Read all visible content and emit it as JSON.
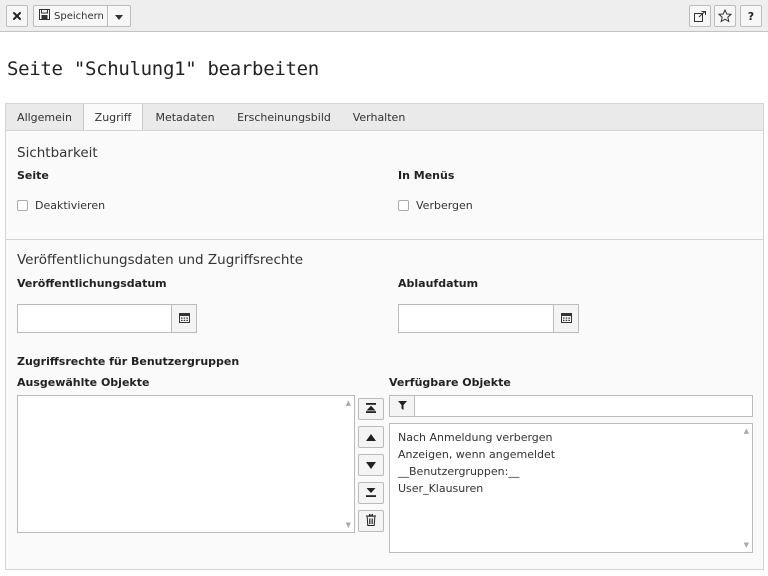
{
  "toolbar": {
    "save_label": "Speichern"
  },
  "page": {
    "title": "Seite \"Schulung1\" bearbeiten"
  },
  "tabs": [
    {
      "label": "Allgemein"
    },
    {
      "label": "Zugriff",
      "active": true
    },
    {
      "label": "Metadaten"
    },
    {
      "label": "Erscheinungsbild"
    },
    {
      "label": "Verhalten"
    }
  ],
  "visibility": {
    "title": "Sichtbarkeit",
    "page_label": "Seite",
    "disable_label": "Deaktivieren",
    "menus_label": "In Menüs",
    "hide_label": "Verbergen"
  },
  "publish": {
    "title": "Veröffentlichungsdaten und Zugriffsrechte",
    "publish_date_label": "Veröffentlichungsdatum",
    "publish_date_value": "",
    "expire_date_label": "Ablaufdatum",
    "expire_date_value": ""
  },
  "access": {
    "groups_label": "Zugriffsrechte für Benutzergruppen",
    "selected_label": "Ausgewählte Objekte",
    "available_label": "Verfügbare Objekte",
    "filter_value": "",
    "available_items": [
      "Nach Anmeldung verbergen",
      "Anzeigen, wenn angemeldet",
      "__Benutzergruppen:__",
      "User_Klausuren"
    ]
  }
}
